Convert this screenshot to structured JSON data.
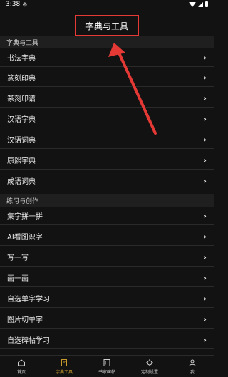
{
  "status_bar": {
    "time": "3:38"
  },
  "header": {
    "title": "字典与工具"
  },
  "sections": [
    {
      "label": "字典与工具",
      "items": [
        "书法字典",
        "篆刻印典",
        "篆刻印谱",
        "汉语字典",
        "汉语词典",
        "康熙字典",
        "成语词典"
      ]
    },
    {
      "label": "练习与创作",
      "items": [
        "集字拼一拼",
        "AI看图识字",
        "写一写",
        "画一画",
        "自选单字学习",
        "图片切单字",
        "自选碑帖学习"
      ]
    }
  ],
  "tabs": [
    {
      "label": "首页",
      "icon": "home-icon",
      "active": false
    },
    {
      "label": "字典工具",
      "icon": "dictionary-tools-icon",
      "active": true
    },
    {
      "label": "书家碑帖",
      "icon": "calligraphy-book-icon",
      "active": false
    },
    {
      "label": "定制设置",
      "icon": "custom-settings-icon",
      "active": false
    },
    {
      "label": "我",
      "icon": "profile-icon",
      "active": false
    }
  ],
  "colors": {
    "accent": "#c79a2b",
    "highlight_red": "#e53935",
    "background": "#121212"
  }
}
